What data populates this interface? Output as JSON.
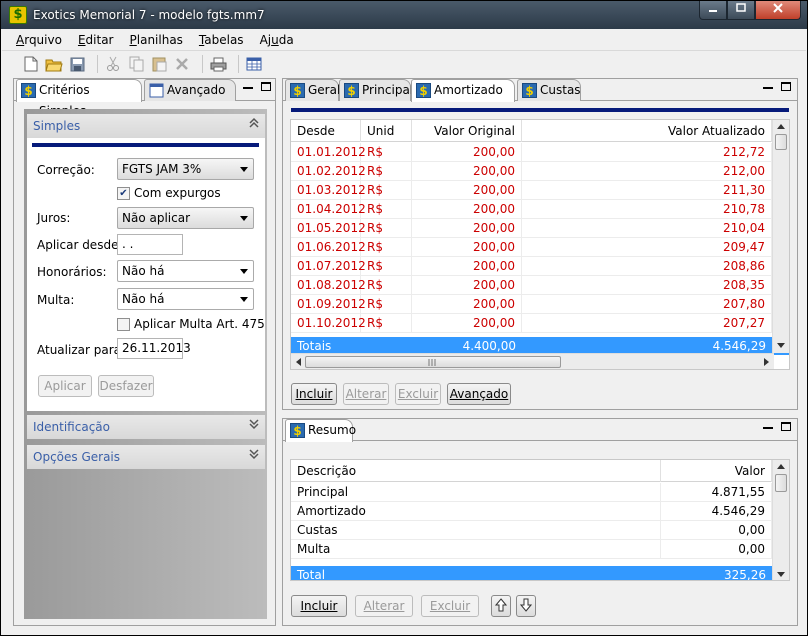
{
  "window": {
    "title": "Exotics Memorial 7 - modelo fgts.mm7",
    "app_icon": "$"
  },
  "menu": [
    {
      "label": "Arquivo",
      "mnemonic": "A",
      "rest": "rquivo"
    },
    {
      "label": "Editar",
      "mnemonic": "E",
      "rest": "ditar"
    },
    {
      "label": "Planilhas",
      "mnemonic": "P",
      "rest": "lanilhas"
    },
    {
      "label": "Tabelas",
      "mnemonic": "T",
      "rest": "abelas"
    },
    {
      "label": "Ajuda",
      "prefix": "Aj",
      "mnemonic": "u",
      "rest": "da"
    }
  ],
  "toolbar": [
    "new-file-icon",
    "open-folder-icon",
    "save-icon",
    "cut-icon",
    "copy-icon",
    "paste-icon",
    "delete-icon",
    "print-icon",
    "table-icon"
  ],
  "left_panel": {
    "tabs": [
      "Critérios Simples",
      "Avançado"
    ],
    "simples": {
      "header": "Simples",
      "correcao_label": "Correção:",
      "correcao_value": "FGTS JAM 3%",
      "com_expurgos_label": "Com expurgos",
      "com_expurgos_checked": true,
      "juros_label": "Juros:",
      "juros_value": "Não aplicar",
      "aplicar_desde_label": "Aplicar desde:",
      "aplicar_desde_value": " .  .",
      "honorarios_label": "Honorários:",
      "honorarios_value": "Não há",
      "multa_label": "Multa:",
      "multa_value": "Não há",
      "aplicar_multa_label": "Aplicar Multa Art. 475",
      "aplicar_multa_checked": false,
      "atualizar_label": "Atualizar para:",
      "atualizar_value": "26.11.2013",
      "aplicar_button": "Aplicar",
      "desfazer_button": "Desfazer"
    },
    "identificacao_header": "Identificação",
    "opcoes_header": "Opções Gerais"
  },
  "right_top": {
    "tabs": [
      "Geral",
      "Principal",
      "Amortizado",
      "Custas"
    ],
    "active_tab": "Amortizado",
    "columns": [
      "Desde",
      "Unid",
      "Valor Original",
      "Valor Atualizado"
    ],
    "rows": [
      [
        "01.01.2012",
        "R$",
        "200,00",
        "212,72"
      ],
      [
        "01.02.2012",
        "R$",
        "200,00",
        "212,00"
      ],
      [
        "01.03.2012",
        "R$",
        "200,00",
        "211,30"
      ],
      [
        "01.04.2012",
        "R$",
        "200,00",
        "210,78"
      ],
      [
        "01.05.2012",
        "R$",
        "200,00",
        "210,04"
      ],
      [
        "01.06.2012",
        "R$",
        "200,00",
        "209,47"
      ],
      [
        "01.07.2012",
        "R$",
        "200,00",
        "208,86"
      ],
      [
        "01.08.2012",
        "R$",
        "200,00",
        "208,35"
      ],
      [
        "01.09.2012",
        "R$",
        "200,00",
        "207,80"
      ],
      [
        "01.10.2012",
        "R$",
        "200,00",
        "207,27"
      ]
    ],
    "totals": {
      "label": "Totais",
      "original": "4.400,00",
      "atualizado": "4.546,29"
    },
    "buttons": {
      "incluir": "Incluir",
      "alterar": "Alterar",
      "excluir": "Excluir",
      "avancado": "Avançado"
    }
  },
  "right_bottom": {
    "tab": "Resumo",
    "columns": [
      "Descrição",
      "Valor"
    ],
    "rows": [
      [
        "Principal",
        "4.871,55"
      ],
      [
        "Amortizado",
        "4.546,29"
      ],
      [
        "Custas",
        "0,00"
      ],
      [
        "Multa",
        "0,00"
      ]
    ],
    "total": {
      "label": "Total",
      "value": "325,26"
    },
    "buttons": {
      "incluir": "Incluir",
      "alterar": "Alterar",
      "excluir": "Excluir"
    }
  },
  "colors": {
    "accent_blue": "#061a7a",
    "selection": "#3399ff",
    "value_red": "#cc0000",
    "link_blue": "#3a5fa8"
  }
}
